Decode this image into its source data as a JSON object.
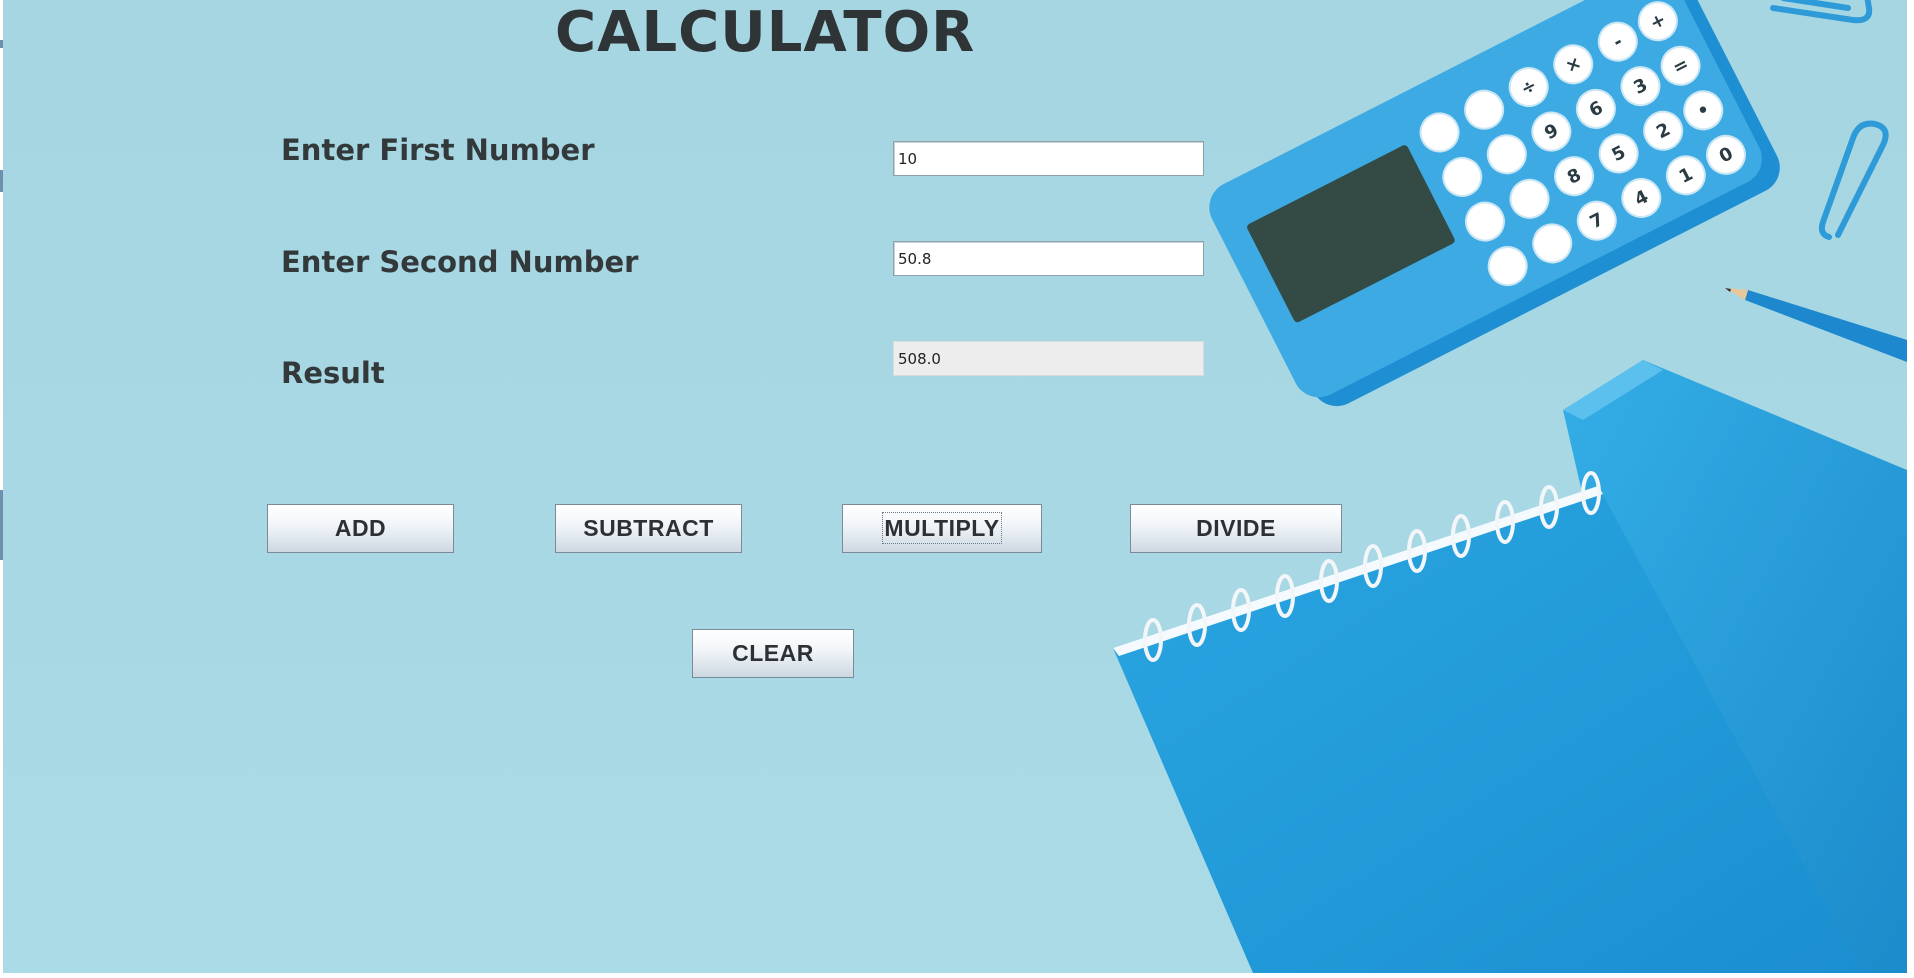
{
  "title": "CALCULATOR",
  "fields": {
    "first": {
      "label": "Enter First Number",
      "value": "10"
    },
    "second": {
      "label": "Enter Second Number",
      "value": "50.8"
    },
    "result": {
      "label": "Result",
      "value": "508.0"
    }
  },
  "buttons": {
    "add": "ADD",
    "subtract": "SUBTRACT",
    "multiply": "MULTIPLY",
    "divide": "DIVIDE",
    "clear": "CLEAR"
  },
  "background_art": {
    "items": [
      "calculator",
      "paper-clip",
      "pencil",
      "spiral-notebook"
    ],
    "calculator_keys": [
      "+",
      "=",
      "-",
      "3",
      "•",
      "×",
      "÷",
      "6",
      "2",
      "0",
      "9",
      "5",
      "1",
      "8",
      "4",
      "7"
    ]
  },
  "colors": {
    "background": "#a8d8e4",
    "accent_blue": "#1e9ad6",
    "button_text": "#2d3134",
    "label_text": "#33393b"
  }
}
